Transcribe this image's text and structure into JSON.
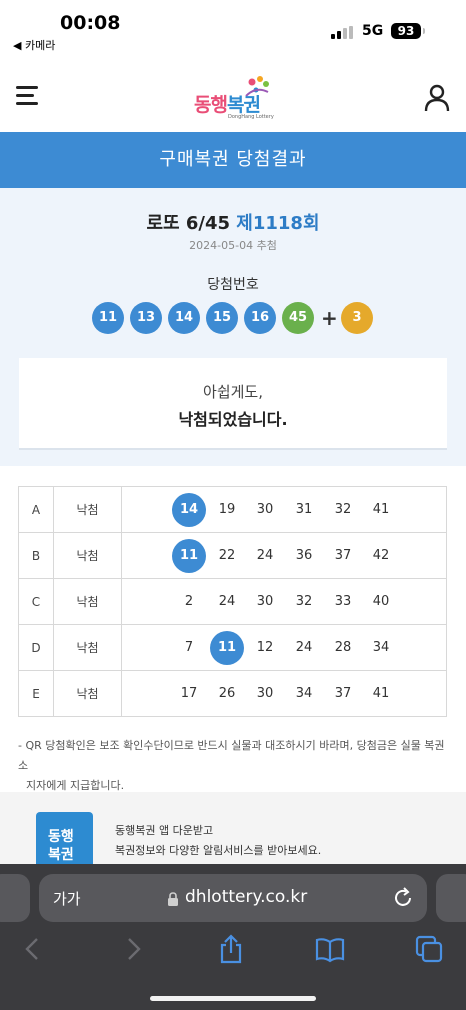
{
  "status_bar": {
    "time": "00:08",
    "back_app": "◀ 카메라",
    "network": "5G",
    "battery": "93"
  },
  "header": {
    "logo_text_1": "동행",
    "logo_text_2": "복권",
    "logo_sub": "DongHang Lottery",
    "menu_icon": "hamburger-icon",
    "user_icon": "user-icon"
  },
  "page_title": "구매복권 당첨결과",
  "result": {
    "game_name": "로또 6/45",
    "round": "제1118회",
    "draw_date": "2024-05-04 추첨",
    "winning_label": "당첨번호",
    "winning_numbers": [
      "11",
      "13",
      "14",
      "15",
      "16",
      "45"
    ],
    "plus": "+",
    "bonus_number": "3",
    "message_line1": "아쉽게도,",
    "message_line2": "낙첨되었습니다."
  },
  "ticket": {
    "rows": [
      {
        "set": "A",
        "result": "낙첨",
        "numbers": [
          "14",
          "19",
          "30",
          "31",
          "32",
          "41"
        ],
        "hits": [
          0
        ]
      },
      {
        "set": "B",
        "result": "낙첨",
        "numbers": [
          "11",
          "22",
          "24",
          "36",
          "37",
          "42"
        ],
        "hits": [
          0
        ]
      },
      {
        "set": "C",
        "result": "낙첨",
        "numbers": [
          "2",
          "24",
          "30",
          "32",
          "33",
          "40"
        ],
        "hits": []
      },
      {
        "set": "D",
        "result": "낙첨",
        "numbers": [
          "7",
          "11",
          "12",
          "24",
          "28",
          "34"
        ],
        "hits": [
          1
        ]
      },
      {
        "set": "E",
        "result": "낙첨",
        "numbers": [
          "17",
          "26",
          "30",
          "34",
          "37",
          "41"
        ],
        "hits": []
      }
    ]
  },
  "notice": {
    "line1": "- QR 당첨확인은 보조 확인수단이므로 반드시 실물과 대조하시기 바라며, 당첨금은 실물 복권소",
    "line2": "지자에게 지급합니다."
  },
  "promo": {
    "icon_text_1": "동행",
    "icon_text_2": "복권",
    "line1": "동행복권 앱 다운받고",
    "line2": "복권정보와 다양한 알림서비스를 받아보세요."
  },
  "browser": {
    "aa_label": "가가",
    "url": "dhlottery.co.kr",
    "icons": [
      "lock-icon",
      "reload-icon",
      "back-icon",
      "forward-icon",
      "share-icon",
      "bookmarks-icon",
      "tabs-icon"
    ]
  },
  "colors": {
    "primary_blue": "#3d8bd3",
    "ball_blue": "#3d8bd3",
    "ball_green": "#6ab04c",
    "ball_orange": "#e5a92b",
    "round_blue": "#2d7cc6"
  }
}
